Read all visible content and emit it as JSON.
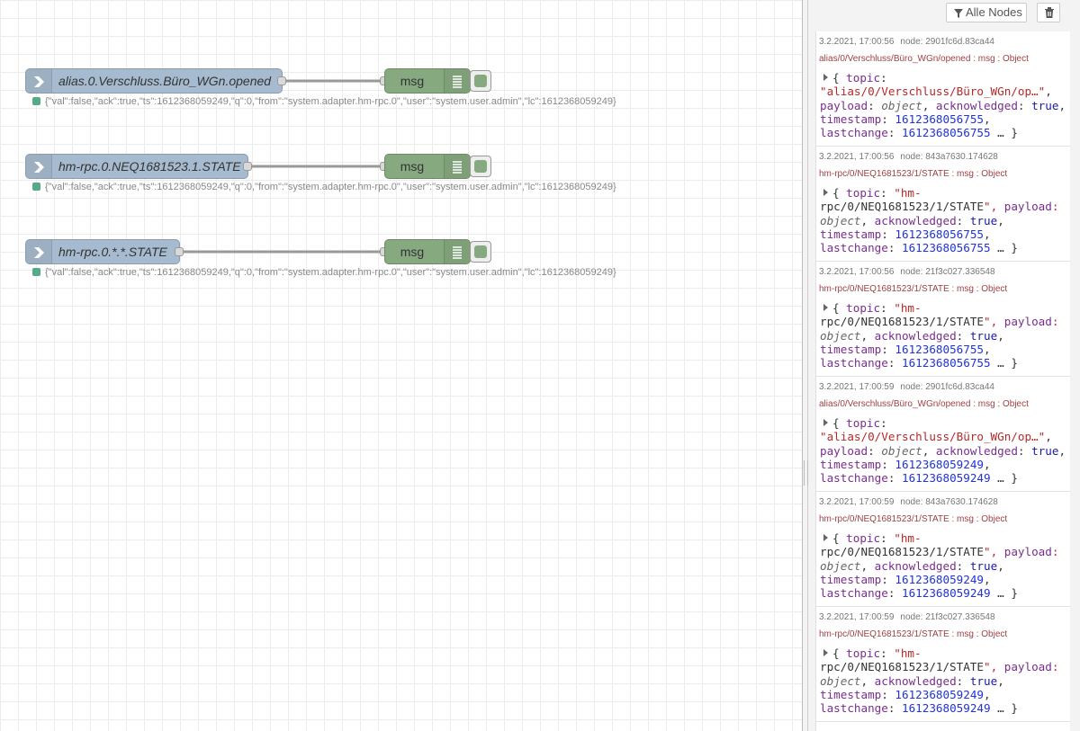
{
  "flows": [
    {
      "input_label": "alias.0.Verschluss.Büro_WGn.opened",
      "debug_label": "msg",
      "status": "{\"val\":false,\"ack\":true,\"ts\":1612368059249,\"q\":0,\"from\":\"system.adapter.hm-rpc.0\",\"user\":\"system.user.admin\",\"lc\":1612368059249}",
      "status_color": "#55aa88"
    },
    {
      "input_label": "hm-rpc.0.NEQ1681523.1.STATE",
      "debug_label": "msg",
      "status": "{\"val\":false,\"ack\":true,\"ts\":1612368059249,\"q\":0,\"from\":\"system.adapter.hm-rpc.0\",\"user\":\"system.user.admin\",\"lc\":1612368059249}",
      "status_color": "#55aa88"
    },
    {
      "input_label": "hm-rpc.0.*.*.STATE",
      "debug_label": "msg",
      "status": "{\"val\":false,\"ack\":true,\"ts\":1612368059249,\"q\":0,\"from\":\"system.adapter.hm-rpc.0\",\"user\":\"system.user.admin\",\"lc\":1612368059249}",
      "status_color": "#55aa88"
    }
  ],
  "sidebar": {
    "filter_label": "Alle Nodes",
    "filter_icon": "filter-icon",
    "clear_icon": "trash-icon"
  },
  "messages": [
    {
      "time": "3.2.2021, 17:00:56",
      "node": "node: 2901fc6d.83ca44",
      "topic_line": "alias/0/Verschluss/Büro_WGn/opened : msg : Object",
      "lines": [
        "{ topic:",
        "\"alias/0/Verschluss/Büro_WGn/op…\",",
        "payload: object, acknowledged: true,",
        "timestamp: 1612368056755,",
        "lastchange: 1612368056755 … }"
      ]
    },
    {
      "time": "3.2.2021, 17:00:56",
      "node": "node: 843a7630.174628",
      "topic_line": "hm-rpc/0/NEQ1681523/1/STATE : msg : Object",
      "lines": [
        "{ topic: \"hm-",
        "rpc/0/NEQ1681523/1/STATE\", payload:",
        "object, acknowledged: true,",
        "timestamp: 1612368056755,",
        "lastchange: 1612368056755 … }"
      ]
    },
    {
      "time": "3.2.2021, 17:00:56",
      "node": "node: 21f3c027.336548",
      "topic_line": "hm-rpc/0/NEQ1681523/1/STATE : msg : Object",
      "lines": [
        "{ topic: \"hm-",
        "rpc/0/NEQ1681523/1/STATE\", payload:",
        "object, acknowledged: true,",
        "timestamp: 1612368056755,",
        "lastchange: 1612368056755 … }"
      ]
    },
    {
      "time": "3.2.2021, 17:00:59",
      "node": "node: 2901fc6d.83ca44",
      "topic_line": "alias/0/Verschluss/Büro_WGn/opened : msg : Object",
      "lines": [
        "{ topic:",
        "\"alias/0/Verschluss/Büro_WGn/op…\",",
        "payload: object, acknowledged: true,",
        "timestamp: 1612368059249,",
        "lastchange: 1612368059249 … }"
      ]
    },
    {
      "time": "3.2.2021, 17:00:59",
      "node": "node: 843a7630.174628",
      "topic_line": "hm-rpc/0/NEQ1681523/1/STATE : msg : Object",
      "lines": [
        "{ topic: \"hm-",
        "rpc/0/NEQ1681523/1/STATE\", payload:",
        "object, acknowledged: true,",
        "timestamp: 1612368059249,",
        "lastchange: 1612368059249 … }"
      ]
    },
    {
      "time": "3.2.2021, 17:00:59",
      "node": "node: 21f3c027.336548",
      "topic_line": "hm-rpc/0/NEQ1681523/1/STATE : msg : Object",
      "lines": [
        "{ topic: \"hm-",
        "rpc/0/NEQ1681523/1/STATE\", payload:",
        "object, acknowledged: true,",
        "timestamp: 1612368059249,",
        "lastchange: 1612368059249 … }"
      ]
    }
  ]
}
